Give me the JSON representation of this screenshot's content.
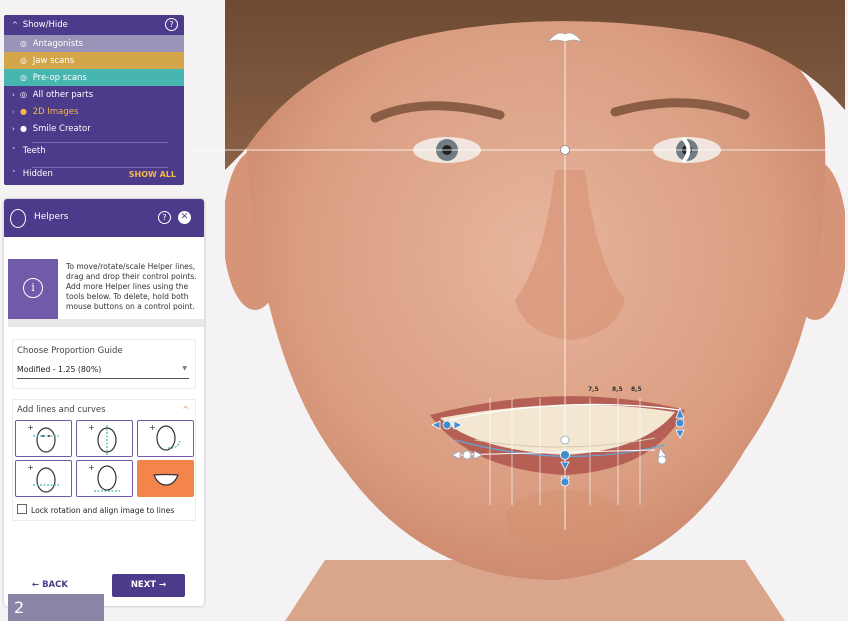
{
  "show_hide": {
    "title": "Show/Hide",
    "rows": [
      {
        "label": "Antagonists"
      },
      {
        "label": "Jaw scans"
      },
      {
        "label": "Pre-op scans"
      },
      {
        "label": "All other parts"
      },
      {
        "label": "2D Images"
      },
      {
        "label": "Smile Creator"
      },
      {
        "label": "Teeth"
      },
      {
        "label": "Hidden"
      }
    ],
    "show_all": "SHOW ALL"
  },
  "helpers": {
    "title": "Helpers",
    "info_text": "To move/rotate/scale Helper lines, drag and drop their control points. Add more Helper lines using the tools below. To delete, hold both mouse buttons on a control point.",
    "proportion_label": "Choose Proportion Guide",
    "proportion_value": "Modified - 1.25 (80%)",
    "lines_label": "Add lines and curves",
    "lock_label": "Lock rotation and align image to lines",
    "back_label": "← BACK",
    "next_label": "NEXT →"
  },
  "measurements": [
    "7,5",
    "8,5",
    "8,5"
  ],
  "badge": "2",
  "colors": {
    "purple": "#4c3a8a",
    "orange": "#f4854a",
    "teal": "#47b5b0",
    "gold": "#d4a64a",
    "handle_blue": "#3f8fd0"
  }
}
